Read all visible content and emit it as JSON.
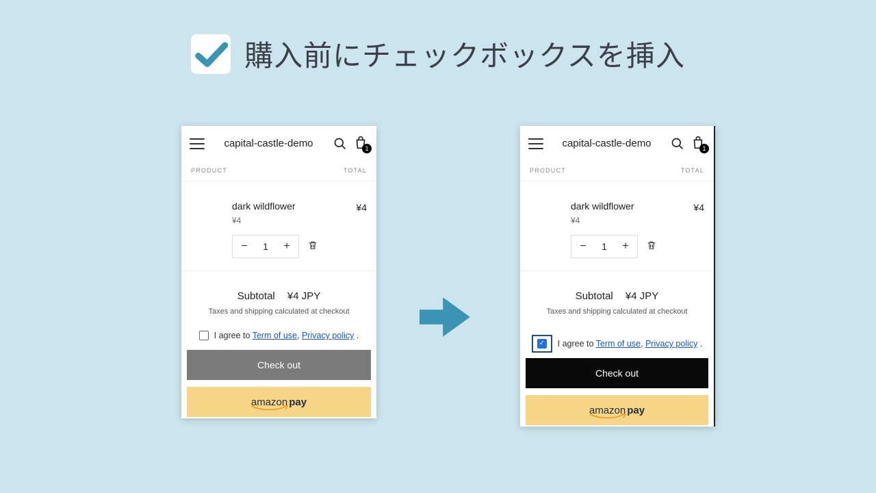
{
  "headline": "購入前にチェックボックスを挿入",
  "store": {
    "title": "capital-castle-demo",
    "cart_count": "1"
  },
  "table": {
    "product": "PRODUCT",
    "total": "TOTAL"
  },
  "item": {
    "name": "dark wildflower",
    "unit_price": "¥4",
    "qty": "1",
    "line_total": "¥4"
  },
  "summary": {
    "subtotal_label": "Subtotal",
    "subtotal_value": "¥4 JPY",
    "tax_note": "Taxes and shipping calculated at checkout"
  },
  "agree": {
    "prefix": "I agree to ",
    "terms": "Term of use",
    "sep": ", ",
    "privacy": "Privacy policy",
    "suffix": " ."
  },
  "buttons": {
    "checkout": "Check out",
    "amazon_a": "amazon",
    "amazon_b": "pay"
  }
}
